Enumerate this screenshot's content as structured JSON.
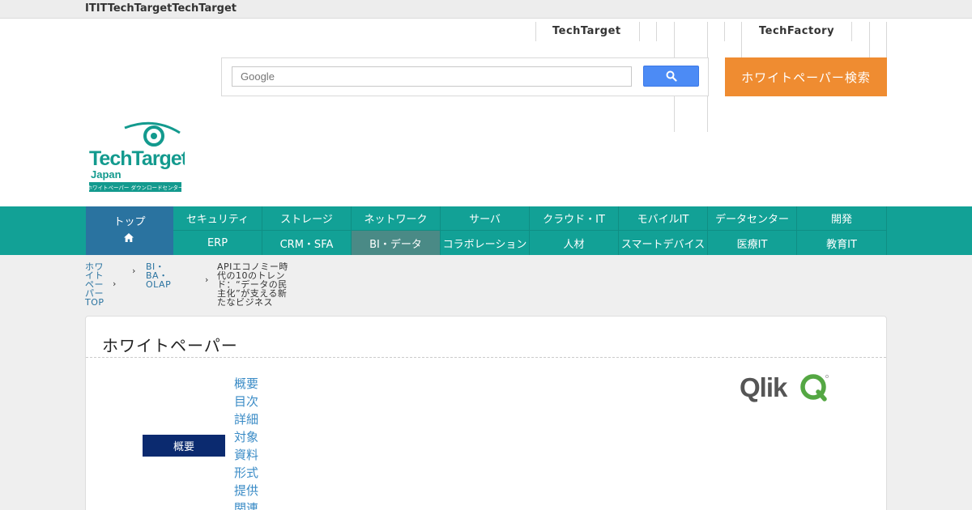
{
  "topbar": {
    "text": "ITITTechTargetTechTarget"
  },
  "header": {
    "links": {
      "techtarget": "TechTarget",
      "techfactory": "TechFactory"
    },
    "search": {
      "placeholder": "Google"
    },
    "action_button": "ホワイトペーパー検索",
    "logo": {
      "line1": "TechTarget",
      "line2": "Japan",
      "tagline": "ホワイトペーパー ダウンロードセンター"
    }
  },
  "nav": {
    "home": {
      "label": "トップ"
    },
    "top_row": [
      "セキュリティ",
      "ストレージ",
      "ネットワーク",
      "サーバ",
      "クラウド・IT",
      "モバイルIT",
      "データセンター",
      "開発"
    ],
    "bottom_row": [
      "ERP",
      "CRM・SFA",
      "BI・データ",
      "コラボレーション",
      "人材",
      "スマートデバイス",
      "医療IT",
      "教育IT"
    ]
  },
  "breadcrumb": [
    {
      "label": "ホワイトペーパー TOP"
    },
    {
      "label": "BI・BA・OLAP"
    },
    {
      "label": "APIエコノミー時代の10のトレンド：“データの民主化”が支える新たなビジネス"
    }
  ],
  "card": {
    "title": "ホワイトペーパー",
    "tab_active": "概要",
    "tab_links": [
      "概要",
      "目次",
      "詳細",
      "対象",
      "資料",
      "形式",
      "提供",
      "関連"
    ]
  },
  "brand": {
    "qlik": "Qlik"
  },
  "colors": {
    "nav_teal": "#12a196",
    "nav_home": "#2a73a0",
    "orange": "#ef8c31",
    "navy": "#0b2a6f",
    "link_blue": "#3a8bc6",
    "qlik_green": "#54a743"
  }
}
